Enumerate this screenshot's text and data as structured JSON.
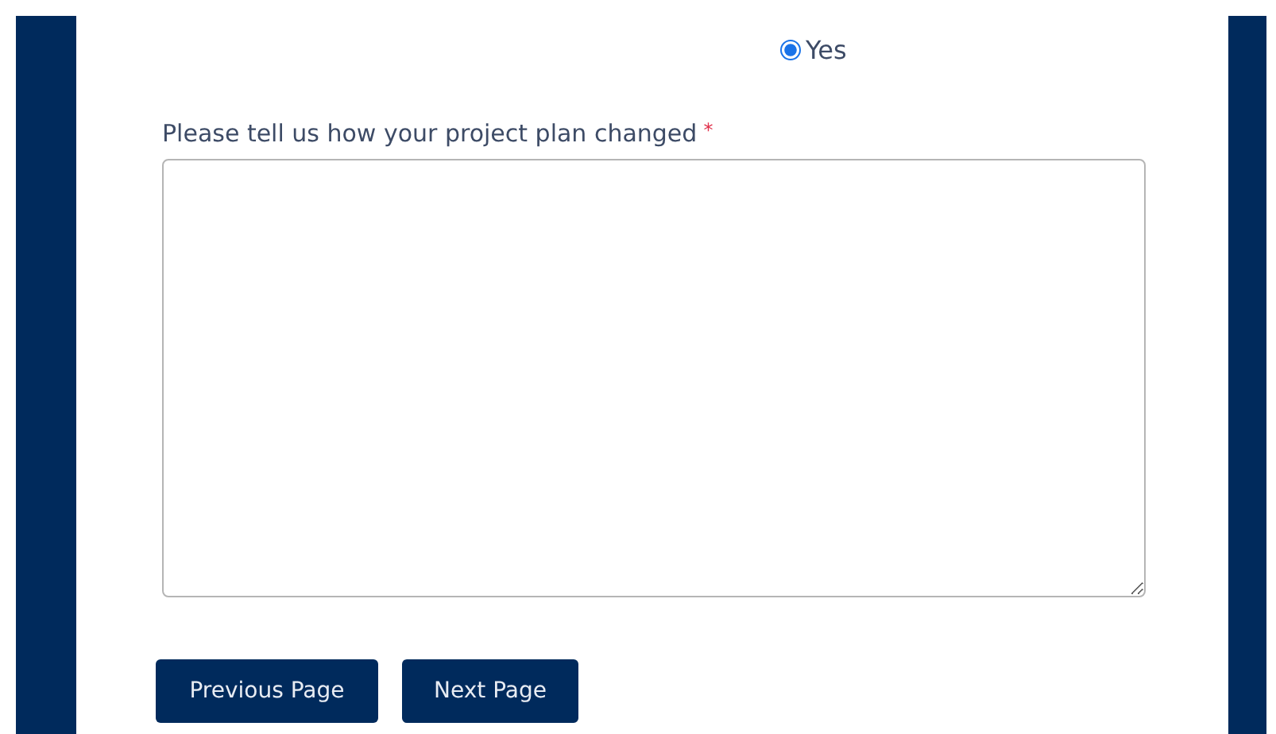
{
  "question_1": {
    "options": [
      {
        "label": "Yes",
        "selected": true
      }
    ]
  },
  "question_2": {
    "label": "Please tell us how your project plan changed",
    "required_mark": "*"
  },
  "buttons": [
    {
      "label": "Previous Page"
    },
    {
      "label": "Next Page"
    }
  ]
}
